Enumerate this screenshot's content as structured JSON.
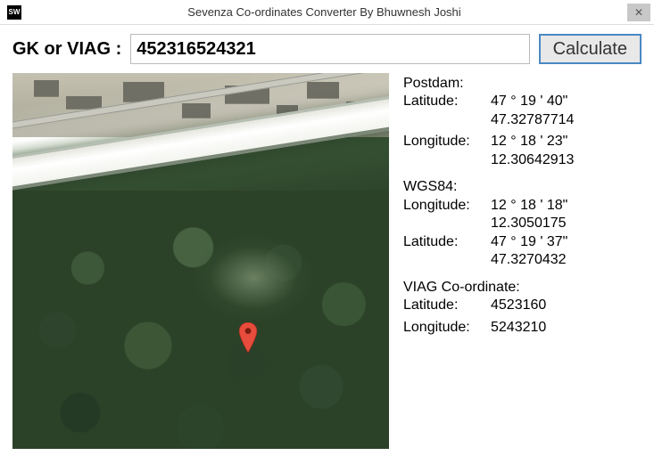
{
  "window": {
    "icon_text": "SW",
    "title": "Sevenza Co-ordinates Converter By Bhuwnesh Joshi",
    "close_glyph": "✕"
  },
  "input": {
    "label": "GK or VIAG :",
    "value": "452316524321",
    "calculate_label": "Calculate"
  },
  "results": {
    "postdam": {
      "heading": "Postdam:",
      "lat_label": "Latitude:",
      "lat_dms": "47 ° 19 ' 40\"",
      "lat_dec": "47.32787714",
      "lon_label": "Longitude:",
      "lon_dms": "12 ° 18 ' 23\"",
      "lon_dec": "12.30642913"
    },
    "wgs84": {
      "heading": "WGS84:",
      "lon_label": "Longitude:",
      "lon_dms": "12 ° 18 ' 18\"",
      "lon_dec": "12.3050175",
      "lat_label": "Latitude:",
      "lat_dms": "47 ° 19 ' 37\"",
      "lat_dec": "47.3270432"
    },
    "viag": {
      "heading": "VIAG Co-ordinate:",
      "lat_label": "Latitude:",
      "lat_val": "4523160",
      "lon_label": "Longitude:",
      "lon_val": "5243210"
    }
  }
}
